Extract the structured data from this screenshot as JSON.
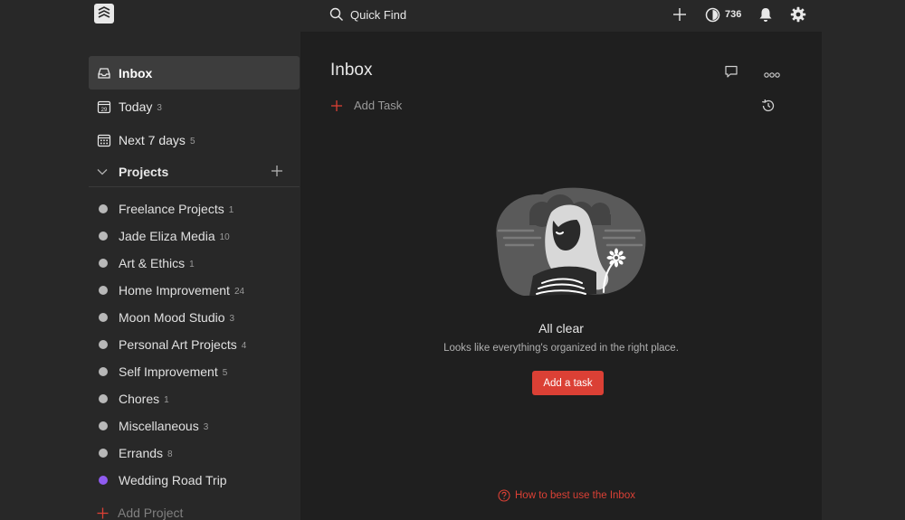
{
  "topbar": {
    "search_label": "Quick Find",
    "karma_count": "736"
  },
  "sidebar": {
    "nav": [
      {
        "label": "Inbox",
        "count": ""
      },
      {
        "label": "Today",
        "count": "3"
      },
      {
        "label": "Next 7 days",
        "count": "5"
      }
    ],
    "projects_title": "Projects",
    "projects": [
      {
        "label": "Freelance Projects",
        "count": "1",
        "color": "#b8b8b8"
      },
      {
        "label": "Jade Eliza Media",
        "count": "10",
        "color": "#b8b8b8"
      },
      {
        "label": "Art & Ethics",
        "count": "1",
        "color": "#b8b8b8"
      },
      {
        "label": "Home Improvement",
        "count": "24",
        "color": "#b8b8b8"
      },
      {
        "label": "Moon Mood Studio",
        "count": "3",
        "color": "#b8b8b8"
      },
      {
        "label": "Personal Art Projects",
        "count": "4",
        "color": "#b8b8b8"
      },
      {
        "label": "Self Improvement",
        "count": "5",
        "color": "#b8b8b8"
      },
      {
        "label": "Chores",
        "count": "1",
        "color": "#b8b8b8"
      },
      {
        "label": "Miscellaneous",
        "count": "3",
        "color": "#b8b8b8"
      },
      {
        "label": "Errands",
        "count": "8",
        "color": "#b8b8b8"
      },
      {
        "label": "Wedding Road Trip",
        "count": "",
        "color": "#8f5bf0"
      }
    ],
    "add_project_label": "Add Project"
  },
  "main": {
    "title": "Inbox",
    "add_task_label": "Add Task",
    "empty_title": "All clear",
    "empty_subtitle": "Looks like everything's organized in the right place.",
    "add_task_button": "Add a task",
    "help_link": "How to best use the Inbox"
  },
  "colors": {
    "accent": "#db4035",
    "background": "#1f1f1f",
    "sidebar": "#282828"
  }
}
